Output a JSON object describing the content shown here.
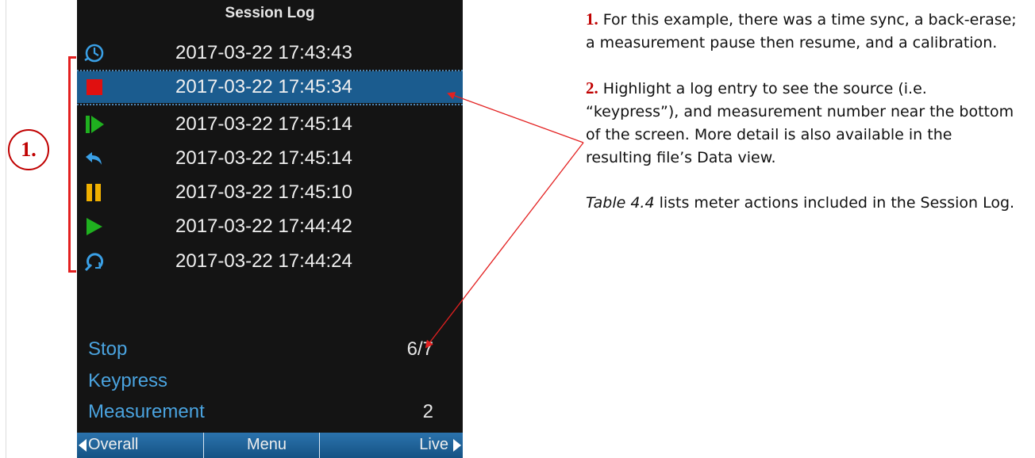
{
  "screen": {
    "title": "Session Log",
    "log_entries": [
      {
        "icon": "time-sync-icon",
        "timestamp": "2017-03-22 17:43:43"
      },
      {
        "icon": "stop-icon",
        "timestamp": "2017-03-22 17:45:34",
        "selected": true
      },
      {
        "icon": "resume-icon",
        "timestamp": "2017-03-22 17:45:14"
      },
      {
        "icon": "back-erase-icon",
        "timestamp": "2017-03-22 17:45:14"
      },
      {
        "icon": "pause-icon",
        "timestamp": "2017-03-22 17:45:10"
      },
      {
        "icon": "run-icon",
        "timestamp": "2017-03-22 17:44:42"
      },
      {
        "icon": "calibration-icon",
        "timestamp": "2017-03-22 17:44:24"
      }
    ],
    "details": {
      "action": "Stop",
      "position": "6/7",
      "source": "Keypress",
      "measurement_label": "Measurement",
      "measurement_value": "2"
    },
    "softkeys": {
      "left": "Overall",
      "center": "Menu",
      "right": "Live"
    }
  },
  "callout": {
    "label": "1."
  },
  "notes": [
    {
      "number": "1.",
      "text": "For this example, there was a time sync, a back-erase; a measurement pause then resume, and a calibration."
    },
    {
      "number": "2.",
      "text": "Highlight a log entry to see the source (i.e. “keypress”), and measurement number near the bottom of the screen. More detail is also available in the resulting file’s Data view."
    }
  ],
  "table_note": {
    "ref": "Table 4.4",
    "text": " lists meter actions included in the Session Log."
  },
  "colors": {
    "selected_row": "#1b5c8f",
    "annotation_red": "#e32020",
    "info_blue": "#4aa3df",
    "softkey_bar": "#1f66a0"
  }
}
